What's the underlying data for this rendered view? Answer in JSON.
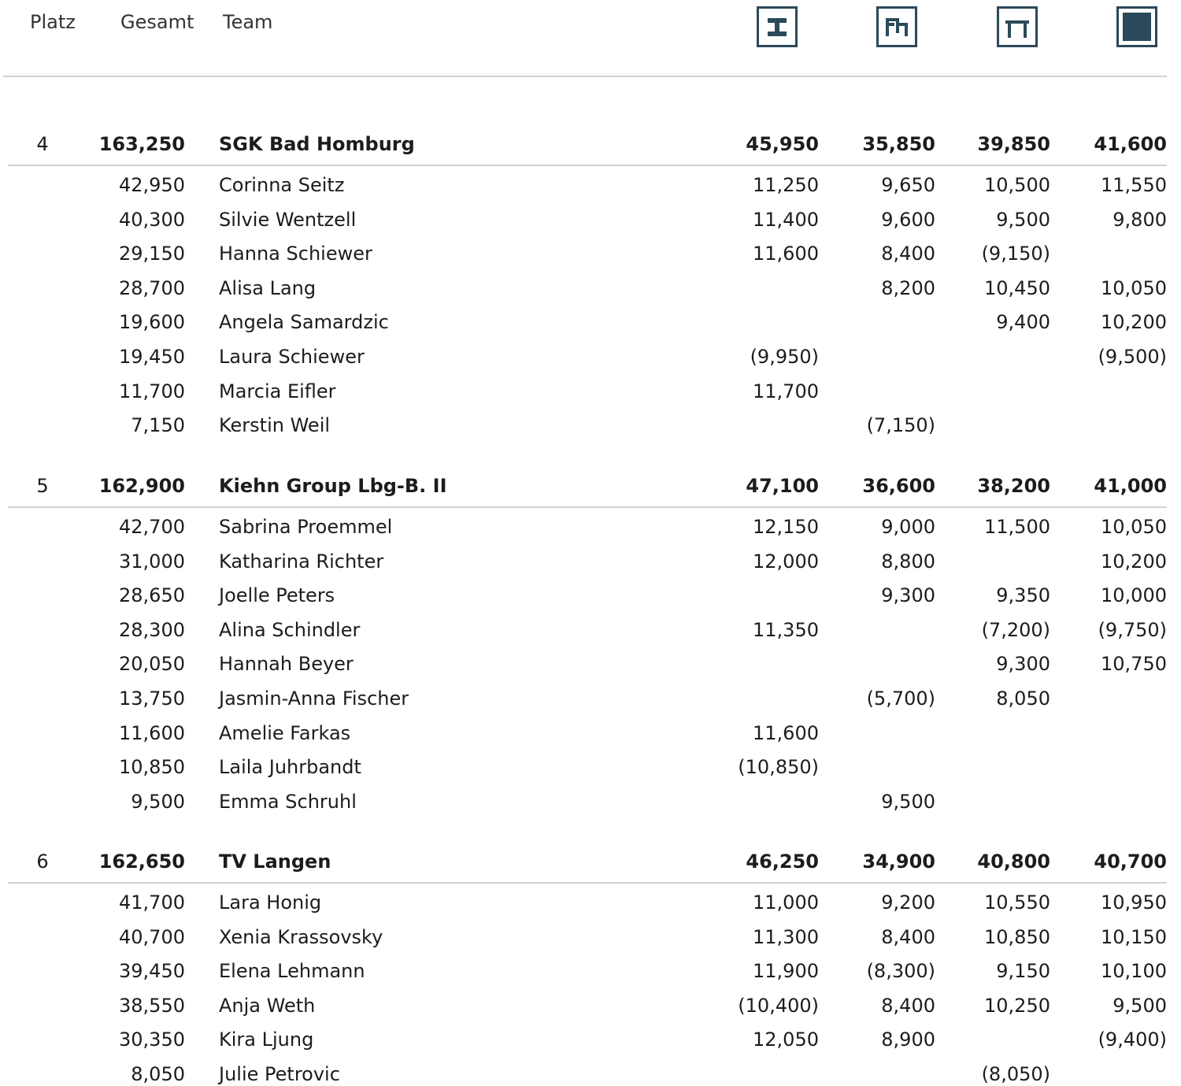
{
  "header": {
    "rank_label": "Platz",
    "total_label": "Gesamt",
    "team_label": "Team",
    "apparatus": [
      {
        "icon": "vault-icon"
      },
      {
        "icon": "uneven-bars-icon"
      },
      {
        "icon": "balance-beam-icon"
      },
      {
        "icon": "floor-icon"
      }
    ]
  },
  "colors": {
    "icon": "#2c4a5a",
    "divider": "#d2d2d2"
  },
  "teams": [
    {
      "rank": "4",
      "total": "163,250",
      "name": "SGK Bad Homburg",
      "scores": [
        "45,950",
        "35,850",
        "39,850",
        "41,600"
      ],
      "athletes": [
        {
          "total": "42,950",
          "name": "Corinna Seitz",
          "scores": [
            "11,250",
            "9,650",
            "10,500",
            "11,550"
          ]
        },
        {
          "total": "40,300",
          "name": "Silvie Wentzell",
          "scores": [
            "11,400",
            "9,600",
            "9,500",
            "9,800"
          ]
        },
        {
          "total": "29,150",
          "name": "Hanna Schiewer",
          "scores": [
            "11,600",
            "8,400",
            "(9,150)",
            ""
          ]
        },
        {
          "total": "28,700",
          "name": "Alisa Lang",
          "scores": [
            "",
            "8,200",
            "10,450",
            "10,050"
          ]
        },
        {
          "total": "19,600",
          "name": "Angela Samardzic",
          "scores": [
            "",
            "",
            "9,400",
            "10,200"
          ]
        },
        {
          "total": "19,450",
          "name": "Laura Schiewer",
          "scores": [
            "(9,950)",
            "",
            "",
            "(9,500)"
          ]
        },
        {
          "total": "11,700",
          "name": "Marcia Eifler",
          "scores": [
            "11,700",
            "",
            "",
            ""
          ]
        },
        {
          "total": "7,150",
          "name": "Kerstin Weil",
          "scores": [
            "",
            "(7,150)",
            "",
            ""
          ]
        }
      ]
    },
    {
      "rank": "5",
      "total": "162,900",
      "name": "Kiehn Group Lbg-B. II",
      "scores": [
        "47,100",
        "36,600",
        "38,200",
        "41,000"
      ],
      "athletes": [
        {
          "total": "42,700",
          "name": "Sabrina Proemmel",
          "scores": [
            "12,150",
            "9,000",
            "11,500",
            "10,050"
          ]
        },
        {
          "total": "31,000",
          "name": "Katharina Richter",
          "scores": [
            "12,000",
            "8,800",
            "",
            "10,200"
          ]
        },
        {
          "total": "28,650",
          "name": "Joelle Peters",
          "scores": [
            "",
            "9,300",
            "9,350",
            "10,000"
          ]
        },
        {
          "total": "28,300",
          "name": "Alina Schindler",
          "scores": [
            "11,350",
            "",
            "(7,200)",
            "(9,750)"
          ]
        },
        {
          "total": "20,050",
          "name": "Hannah Beyer",
          "scores": [
            "",
            "",
            "9,300",
            "10,750"
          ]
        },
        {
          "total": "13,750",
          "name": "Jasmin-Anna Fischer",
          "scores": [
            "",
            "(5,700)",
            "8,050",
            ""
          ]
        },
        {
          "total": "11,600",
          "name": "Amelie Farkas",
          "scores": [
            "11,600",
            "",
            "",
            ""
          ]
        },
        {
          "total": "10,850",
          "name": "Laila Juhrbandt",
          "scores": [
            "(10,850)",
            "",
            "",
            ""
          ]
        },
        {
          "total": "9,500",
          "name": "Emma Schruhl",
          "scores": [
            "",
            "9,500",
            "",
            ""
          ]
        }
      ]
    },
    {
      "rank": "6",
      "total": "162,650",
      "name": "TV Langen",
      "scores": [
        "46,250",
        "34,900",
        "40,800",
        "40,700"
      ],
      "athletes": [
        {
          "total": "41,700",
          "name": "Lara Honig",
          "scores": [
            "11,000",
            "9,200",
            "10,550",
            "10,950"
          ]
        },
        {
          "total": "40,700",
          "name": "Xenia Krassovsky",
          "scores": [
            "11,300",
            "8,400",
            "10,850",
            "10,150"
          ]
        },
        {
          "total": "39,450",
          "name": "Elena Lehmann",
          "scores": [
            "11,900",
            "(8,300)",
            "9,150",
            "10,100"
          ]
        },
        {
          "total": "38,550",
          "name": "Anja Weth",
          "scores": [
            "(10,400)",
            "8,400",
            "10,250",
            "9,500"
          ]
        },
        {
          "total": "30,350",
          "name": "Kira Ljung",
          "scores": [
            "12,050",
            "8,900",
            "",
            "(9,400)"
          ]
        },
        {
          "total": "8,050",
          "name": "Julie Petrovic",
          "scores": [
            "",
            "",
            "(8,050)",
            ""
          ]
        }
      ]
    }
  ]
}
